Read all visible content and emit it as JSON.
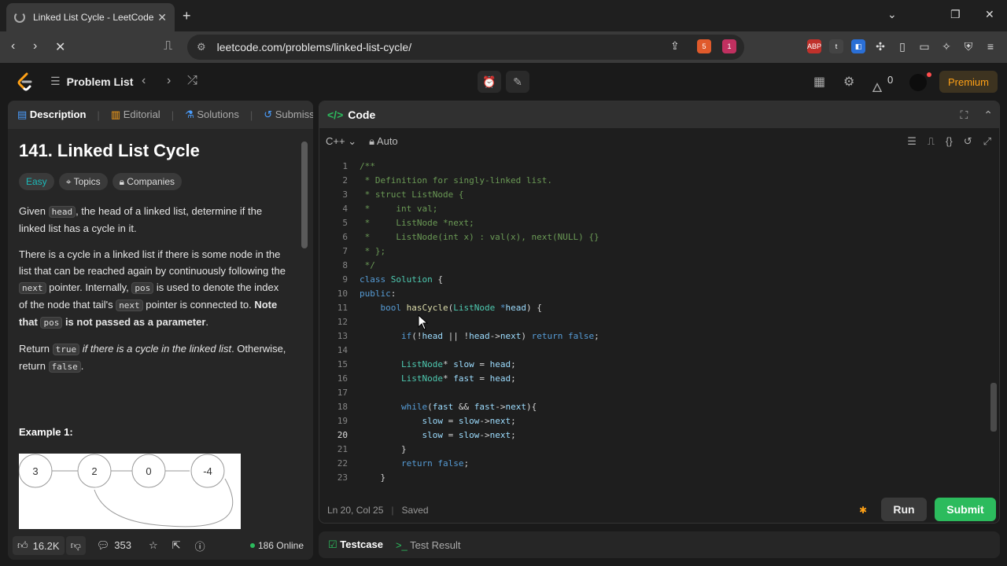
{
  "browser": {
    "tab_title": "Linked List Cycle - LeetCode",
    "url": "leetcode.com/problems/linked-list-cycle/",
    "brave_badge": "5",
    "alert_badge": "1"
  },
  "header": {
    "problem_list": "Problem List",
    "streak_count": "0",
    "premium": "Premium"
  },
  "left_tabs": {
    "description": "Description",
    "editorial": "Editorial",
    "solutions": "Solutions",
    "submissions": "Submission"
  },
  "problem": {
    "title": "141. Linked List Cycle",
    "difficulty": "Easy",
    "topics": "Topics",
    "companies": "Companies",
    "p1_a": "Given ",
    "p1_code": "head",
    "p1_b": ", the head of a linked list, determine if the linked list has a cycle in it.",
    "p2_a": "There is a cycle in a linked list if there is some node in the list that can be reached again by continuously following the ",
    "p2_code1": "next",
    "p2_b": " pointer. Internally, ",
    "p2_code2": "pos",
    "p2_c": " is used to denote the index of the node that tail's ",
    "p2_code3": "next",
    "p2_d": " pointer is connected to. ",
    "p2_bold1": "Note that ",
    "p2_code4": "pos",
    "p2_bold2": " is not passed as a parameter",
    "p2_end": ".",
    "p3_a": "Return ",
    "p3_code1": "true",
    "p3_em": " if there is a cycle in the linked list",
    "p3_b": ". Otherwise, return ",
    "p3_code2": "false",
    "p3_end": ".",
    "example_title": "Example 1:",
    "nodes": [
      "3",
      "2",
      "0",
      "-4"
    ]
  },
  "left_footer": {
    "likes": "16.2K",
    "comments": "353",
    "online": "186 Online"
  },
  "code_panel": {
    "title": "Code",
    "language": "C++",
    "mode": "Auto",
    "status_pos": "Ln 20, Col 25",
    "status_saved": "Saved",
    "run": "Run",
    "submit": "Submit"
  },
  "code_lines": [
    "1",
    "2",
    "3",
    "4",
    "5",
    "6",
    "7",
    "8",
    "9",
    "10",
    "11",
    "12",
    "13",
    "14",
    "15",
    "16",
    "17",
    "18",
    "19",
    "20",
    "21",
    "22",
    "23"
  ],
  "bottom": {
    "testcase": "Testcase",
    "test_result": "Test Result"
  },
  "colors": {
    "accent_green": "#2cbb5d",
    "premium_orange": "#ffa116",
    "easy_teal": "#1cbaba"
  }
}
